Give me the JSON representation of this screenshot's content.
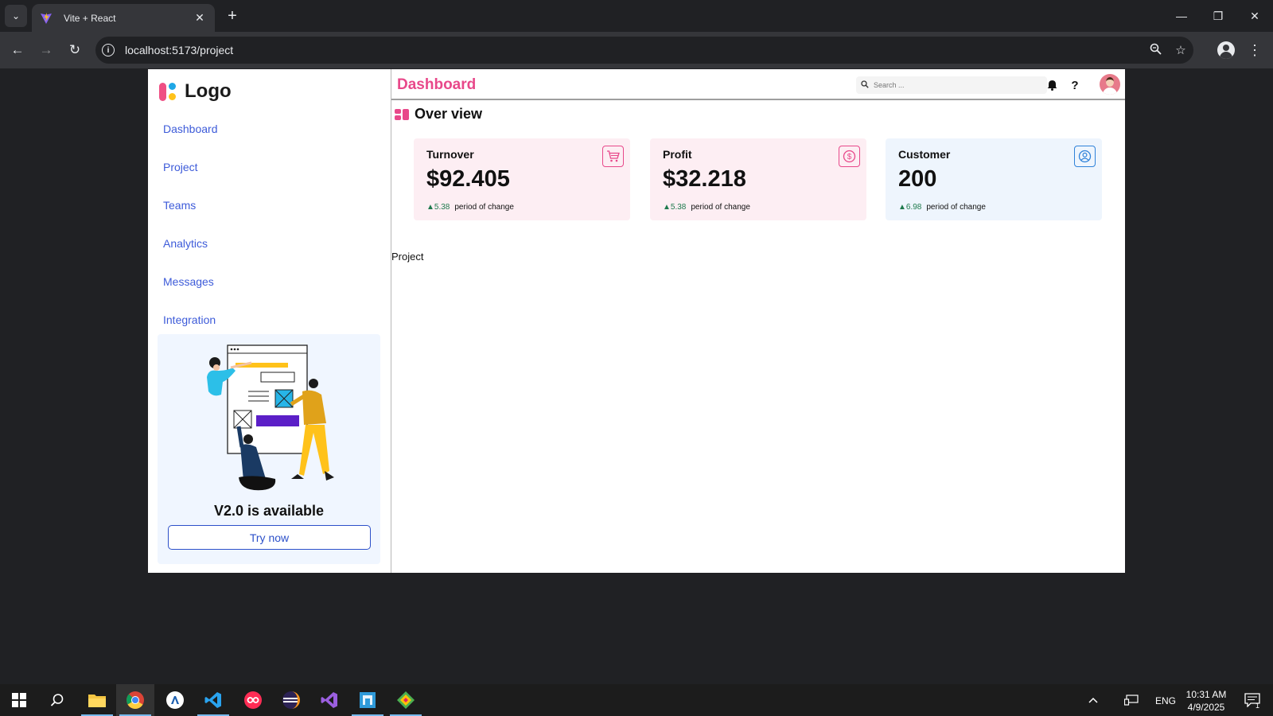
{
  "browser": {
    "tab_title": "Vite + React",
    "url": "localhost:5173/project"
  },
  "sidebar": {
    "logo_text": "Logo",
    "nav": [
      {
        "label": "Dashboard"
      },
      {
        "label": "Project"
      },
      {
        "label": "Teams"
      },
      {
        "label": "Analytics"
      },
      {
        "label": "Messages"
      },
      {
        "label": "Integration"
      }
    ],
    "promo": {
      "title": "V2.0 is available",
      "button_label": "Try now"
    }
  },
  "header": {
    "title": "Dashboard",
    "search_placeholder": "Search ..."
  },
  "overview": {
    "title": "Over view",
    "cards": [
      {
        "label": "Turnover",
        "value": "$92.405",
        "delta": "5.38",
        "change_text": "period of change",
        "icon": "cart-icon",
        "bg": "#fdeef3",
        "accent": "#e8488a"
      },
      {
        "label": "Profit",
        "value": "$32.218",
        "delta": "5.38",
        "change_text": "period of change",
        "icon": "dollar-icon",
        "bg": "#fdeef3",
        "accent": "#e8488a"
      },
      {
        "label": "Customer",
        "value": "200",
        "delta": "6.98",
        "change_text": "period of change",
        "icon": "user-icon",
        "bg": "#eef5fd",
        "accent": "#2f82d9"
      }
    ]
  },
  "content": {
    "project_label": "Project"
  },
  "taskbar": {
    "lang": "ENG",
    "time": "10:31 AM",
    "date": "4/9/2025",
    "notification_count": "1"
  }
}
